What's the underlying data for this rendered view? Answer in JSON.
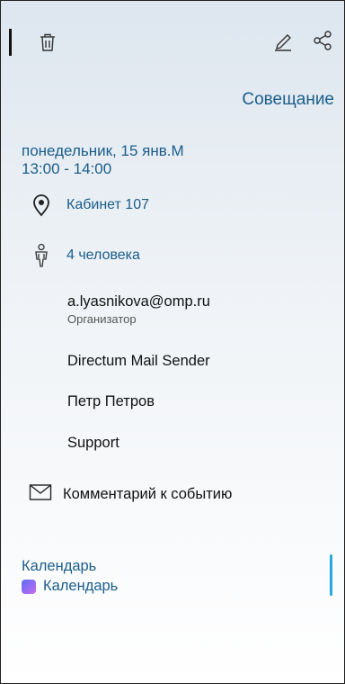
{
  "toolbar": {
    "delete_icon": "trash-icon",
    "edit_icon": "pencil-icon",
    "share_icon": "share-icon"
  },
  "event": {
    "title": "Совещание",
    "date_line": "понедельник, 15 янв.М",
    "time_line": "13:00 - 14:00",
    "location": "Кабинет 107",
    "participants_summary": "4 человека"
  },
  "attendees": [
    {
      "name": "a.lyasnikova@omp.ru",
      "role": "Организатор"
    },
    {
      "name": "Directum Mail Sender"
    },
    {
      "name": "Петр Петров"
    },
    {
      "name": "Support"
    }
  ],
  "comment": {
    "label": "Комментарий к событию"
  },
  "calendar": {
    "label": "Календарь",
    "value": "Календарь"
  },
  "colors": {
    "accent": "#1a5d8a",
    "scroll": "#27a7dd"
  }
}
